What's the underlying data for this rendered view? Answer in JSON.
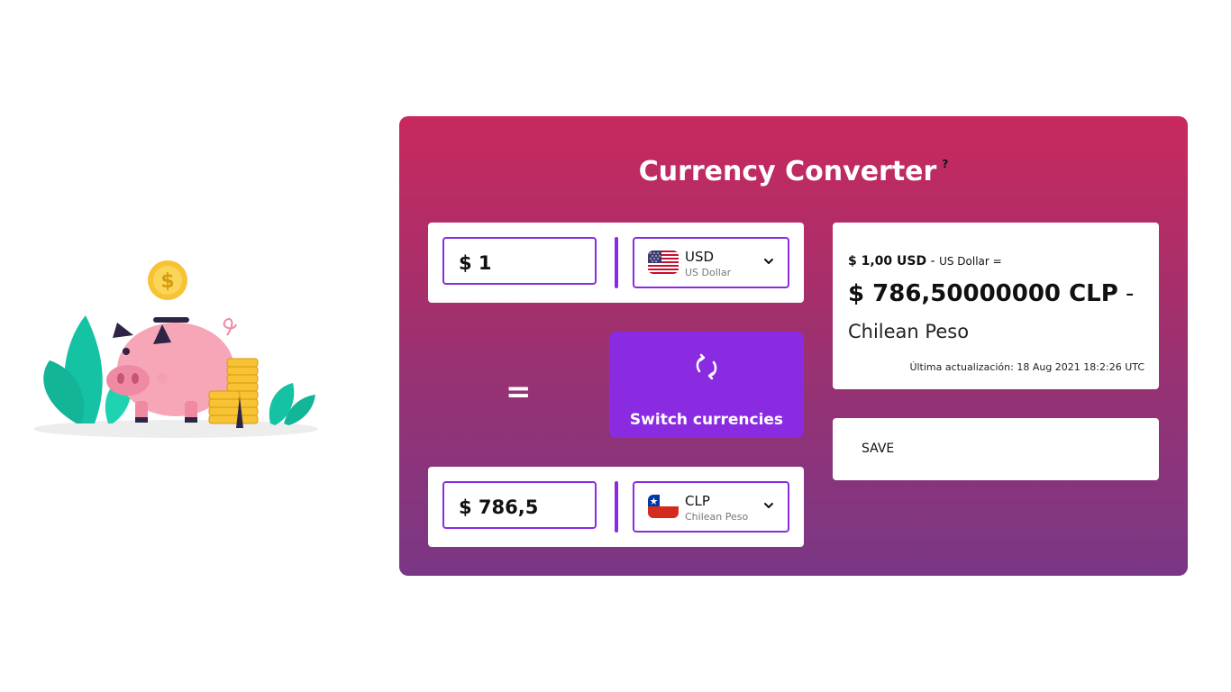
{
  "title": "Currency Converter",
  "help_mark": "?",
  "from": {
    "amount": "$ 1",
    "currency_code": "USD",
    "currency_name": "US Dollar",
    "flag": "us-flag-icon"
  },
  "to": {
    "amount": "$ 786,5",
    "currency_code": "CLP",
    "currency_name": "Chilean Peso",
    "flag": "chile-flag-icon"
  },
  "equals_sign": "=",
  "switch": {
    "label": "Switch currencies",
    "icon": "swap-arrows-icon"
  },
  "result": {
    "from_amount": "$ 1,00 USD",
    "from_name_dash": " - ",
    "from_name": "US Dollar",
    "equals": " =",
    "to_amount": "$ 786,50000000 CLP",
    "to_dash": " -",
    "to_name": "Chilean Peso",
    "updated": "Última actualización: 18 Aug 2021 18:2:26 UTC"
  },
  "save": {
    "label": "SAVE"
  },
  "colors": {
    "accent": "#8a2be2",
    "gradient_top": "#c8295e",
    "gradient_bottom": "#7a3785"
  }
}
